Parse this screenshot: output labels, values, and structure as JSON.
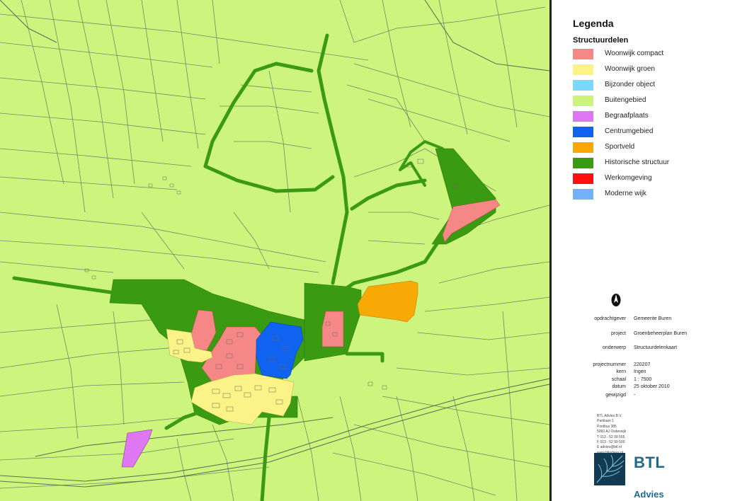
{
  "colors": {
    "background": "#cdf57e",
    "parcel_lines": "#6f8a66",
    "woonwijk_compact": "#f58787",
    "woonwijk_groen": "#fbf387",
    "bijzonder_object": "#7ad8ff",
    "buitengebied": "#ccf47c",
    "begraafplaats": "#df76f2",
    "centrumgebied": "#0f63f0",
    "sportveld": "#f8a905",
    "historische_structuur": "#3a9b12",
    "werkomgeving": "#ff0f0f",
    "moderne_wijk": "#73b1f8"
  },
  "legend": {
    "title": "Legenda",
    "subtitle": "Structuurdelen",
    "items": [
      {
        "label": "Woonwijk compact",
        "color": "#f58787"
      },
      {
        "label": "Woonwijk groen",
        "color": "#fbf387"
      },
      {
        "label": "Bijzonder object",
        "color": "#7ad8ff"
      },
      {
        "label": "Buitengebied",
        "color": "#ccf47c"
      },
      {
        "label": "Begraafplaats",
        "color": "#df76f2"
      },
      {
        "label": "Centrumgebied",
        "color": "#0f63f0"
      },
      {
        "label": "Sportveld",
        "color": "#f8a905"
      },
      {
        "label": "Historische structuur",
        "color": "#3a9b12"
      },
      {
        "label": "Werkomgeving",
        "color": "#ff0f0f"
      },
      {
        "label": "Moderne wijk",
        "color": "#73b1f8"
      }
    ]
  },
  "title_block": {
    "north_arrow_icon": "north-arrow-icon",
    "rows": [
      {
        "key": "opdrachtgever",
        "value": "Gemeente Buren"
      },
      {
        "key": "project",
        "value": "Groenbeheerplan Buren"
      },
      {
        "key": "onderwerp",
        "value": "Structuurdelenkaart"
      },
      {
        "key": "projectnummer",
        "value": "220207"
      },
      {
        "key": "kern",
        "value": "Ingen"
      },
      {
        "key": "schaal",
        "value": "1 : 7500"
      },
      {
        "key": "datum",
        "value": "25 oktober 2010"
      },
      {
        "key": "gewijzigd",
        "value": "-"
      }
    ]
  },
  "company": {
    "address_lines": [
      "BTL Advies B.V.",
      "Parklaan 1",
      "Postbus 385",
      "5060 AJ Oisterwijk",
      "T 013 - 52 99 555",
      "F 013 - 52 99 500",
      "E advies@btl.nl",
      "www.btladvies.nl"
    ],
    "logo_text": "BTL",
    "logo_sub": "Advies",
    "logo_icon": "btl-leaf-logo-icon"
  }
}
